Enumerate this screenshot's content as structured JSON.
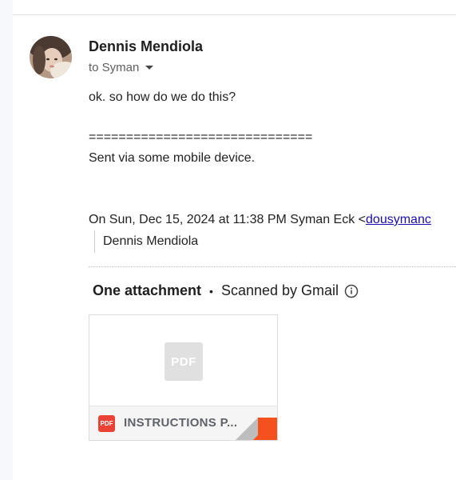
{
  "message": {
    "sender_name": "Dennis Mendiola",
    "recipient_text": "to Syman",
    "body_line": "ok. so how do we do this?",
    "signature_separator": "==============================",
    "signature_text": "Sent via some mobile device.",
    "quote_header_prefix": "On Sun, Dec 15, 2024 at 11:38 PM Syman Eck <",
    "quote_header_link": "dousymanc",
    "quoted_text": "Dennis Mendiola"
  },
  "attachments": {
    "title": "One attachment",
    "separator": "•",
    "scanned_text": "Scanned by Gmail",
    "info_icon": "info-circle-icon",
    "items": [
      {
        "thumb_label": "PDF",
        "badge_label": "PDF",
        "filename": "INSTRUCTIONS P...",
        "icon": "pdf-icon"
      }
    ]
  },
  "colors": {
    "pdf_red": "#ea4335",
    "fold_orange": "#f4511e",
    "link_blue": "#1a0dab"
  }
}
